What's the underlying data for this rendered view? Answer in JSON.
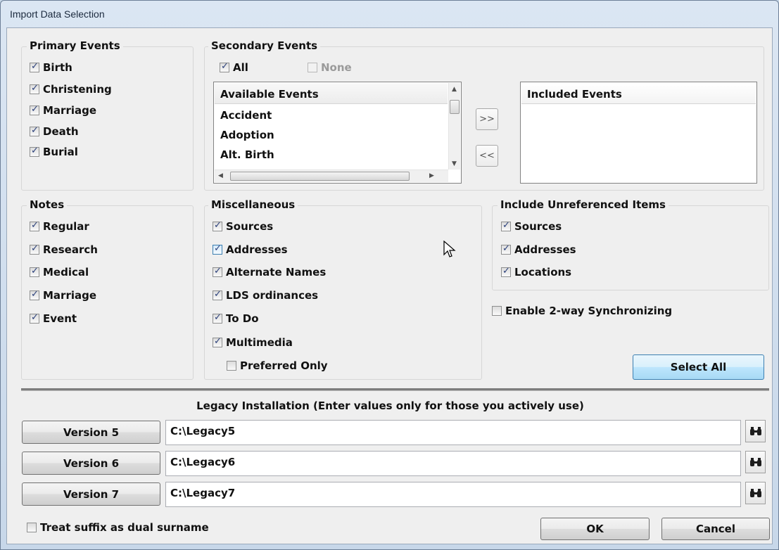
{
  "window": {
    "title": "Import Data Selection"
  },
  "primary_events": {
    "title": "Primary Events",
    "items": [
      {
        "label": "Birth",
        "checked": true
      },
      {
        "label": "Christening",
        "checked": true
      },
      {
        "label": "Marriage",
        "checked": true
      },
      {
        "label": "Death",
        "checked": true
      },
      {
        "label": "Burial",
        "checked": true
      }
    ]
  },
  "secondary_events": {
    "title": "Secondary Events",
    "all_label": "All",
    "all_checked": true,
    "none_label": "None",
    "none_checked": false,
    "available": {
      "header": "Available Events",
      "items": [
        "Accident",
        "Adoption",
        "Alt. Birth"
      ]
    },
    "add_button": ">>",
    "remove_button": "<<",
    "included": {
      "header": "Included Events",
      "items": []
    }
  },
  "notes": {
    "title": "Notes",
    "items": [
      {
        "label": "Regular",
        "checked": true
      },
      {
        "label": "Research",
        "checked": true
      },
      {
        "label": "Medical",
        "checked": true
      },
      {
        "label": "Marriage",
        "checked": true
      },
      {
        "label": "Event",
        "checked": true
      }
    ]
  },
  "miscellaneous": {
    "title": "Miscellaneous",
    "items": [
      {
        "label": "Sources",
        "checked": true
      },
      {
        "label": "Addresses",
        "checked": true
      },
      {
        "label": "Alternate Names",
        "checked": true
      },
      {
        "label": "LDS ordinances",
        "checked": true
      },
      {
        "label": "To Do",
        "checked": true
      },
      {
        "label": "Multimedia",
        "checked": true
      }
    ],
    "preferred_only": {
      "label": "Preferred Only",
      "checked": false
    }
  },
  "unreferenced": {
    "title": "Include Unreferenced Items",
    "items": [
      {
        "label": "Sources",
        "checked": true
      },
      {
        "label": "Addresses",
        "checked": true
      },
      {
        "label": "Locations",
        "checked": true
      }
    ]
  },
  "sync": {
    "label": "Enable 2-way Synchronizing",
    "checked": false
  },
  "select_all_button": "Select All",
  "legacy": {
    "label": "Legacy Installation (Enter values only for those you actively use)",
    "versions": [
      {
        "button": "Version 5",
        "path": "C:\\Legacy5",
        "browse_icon": "binoculars-icon"
      },
      {
        "button": "Version 6",
        "path": "C:\\Legacy6",
        "browse_icon": "binoculars-icon"
      },
      {
        "button": "Version 7",
        "path": "C:\\Legacy7",
        "browse_icon": "binoculars-icon"
      }
    ]
  },
  "suffix": {
    "label": "Treat suffix as dual surname",
    "checked": false
  },
  "ok_button": "OK",
  "cancel_button": "Cancel",
  "colors": {
    "title_bar": "#c7d7e9",
    "dialog_bg": "#efefef",
    "check": "#2a3f7a",
    "default_button": "#bee6fd"
  }
}
